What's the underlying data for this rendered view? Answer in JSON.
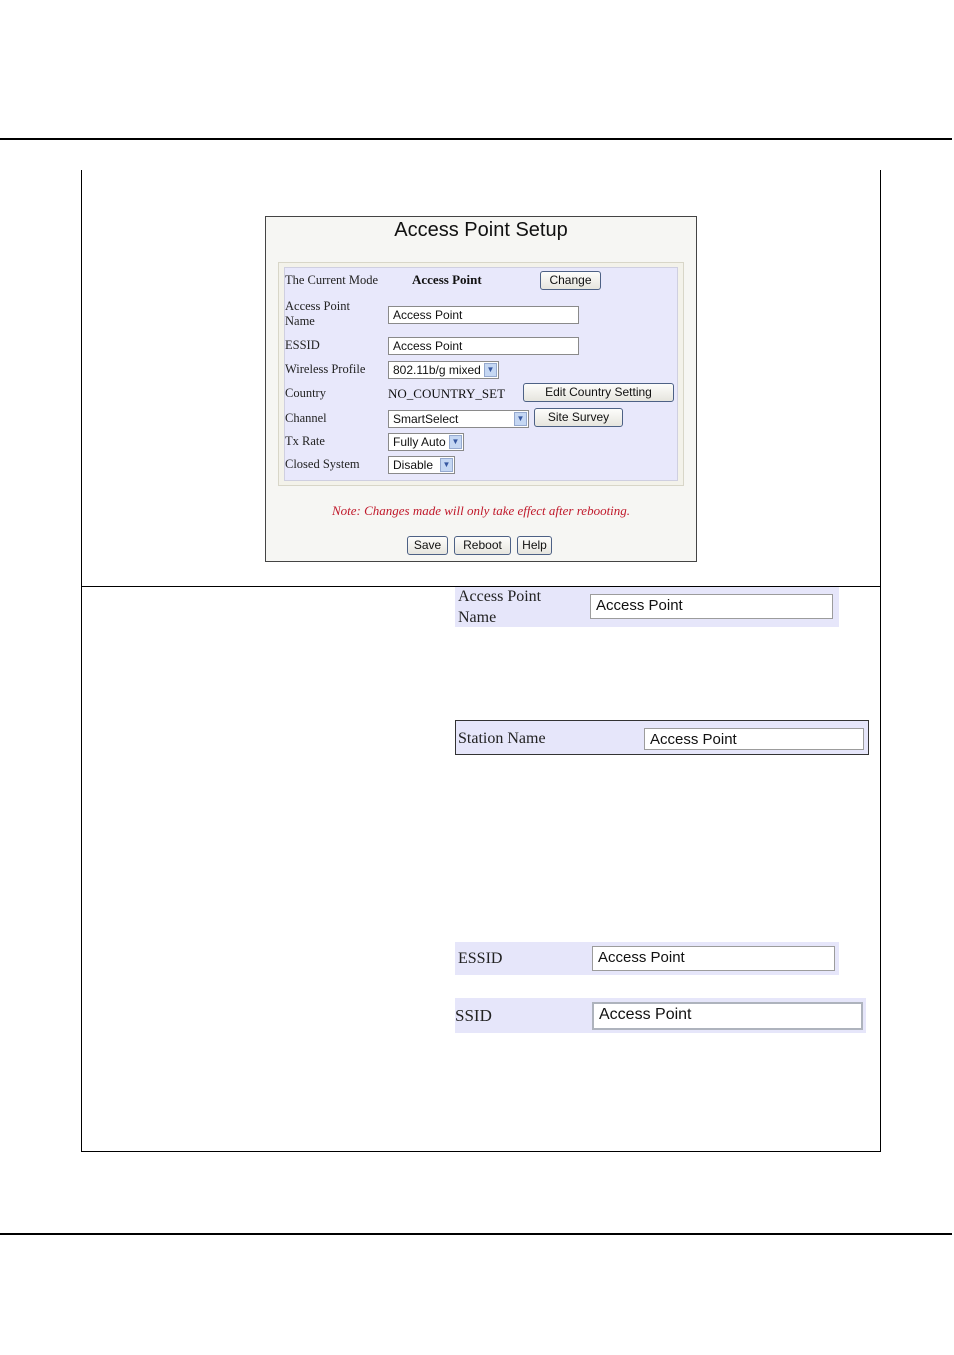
{
  "screenshot": {
    "title": "Access Point Setup",
    "rows": {
      "current_mode": {
        "label": "The Current Mode",
        "value": "Access Point",
        "button": "Change"
      },
      "ap_name": {
        "label_line1": "Access Point",
        "label_line2": "Name",
        "value": "Access Point"
      },
      "essid": {
        "label": "ESSID",
        "value": "Access Point"
      },
      "wireless_profile": {
        "label": "Wireless Profile",
        "selected": "802.11b/g mixed"
      },
      "country": {
        "label": "Country",
        "value": "NO_COUNTRY_SET",
        "button": "Edit Country Setting"
      },
      "channel": {
        "label": "Channel",
        "selected": "SmartSelect",
        "button": "Site Survey"
      },
      "tx_rate": {
        "label": "Tx Rate",
        "selected": "Fully Auto"
      },
      "closed_system": {
        "label": "Closed System",
        "selected": "Disable"
      }
    },
    "note": "Note: Changes made will only take effect after rebooting.",
    "buttons": {
      "save": "Save",
      "reboot": "Reboot",
      "help": "Help"
    },
    "dropdown_icon": "chevron-down-icon"
  },
  "crops": {
    "ap_name": {
      "label_line1": "Access Point",
      "label_line2": "Name",
      "value": "Access Point"
    },
    "station_name": {
      "label": "Station Name",
      "value": "Access Point"
    },
    "essid": {
      "label": "ESSID",
      "value": "Access Point"
    },
    "ssid": {
      "label": "SSID",
      "value": "Access Point"
    }
  },
  "colors": {
    "panel_bg": "#e8e8fb",
    "note_red": "#c0182a",
    "button_border": "#4d6185"
  }
}
